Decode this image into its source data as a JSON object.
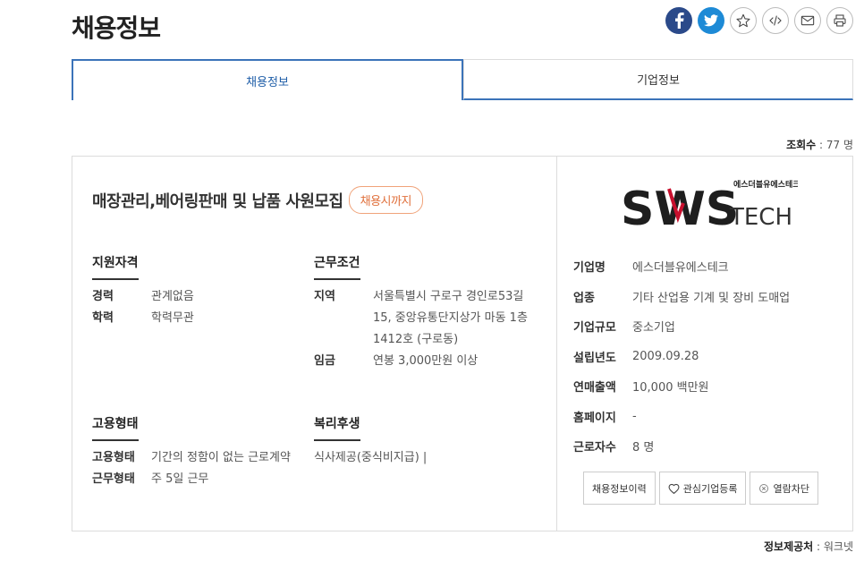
{
  "page": {
    "title": "채용정보"
  },
  "share": {
    "icons": [
      "facebook-icon",
      "twitter-icon",
      "star-icon",
      "code-icon",
      "mail-icon",
      "print-icon"
    ]
  },
  "tabs": [
    {
      "label": "채용정보",
      "active": true
    },
    {
      "label": "기업정보",
      "active": false
    }
  ],
  "views": {
    "label": "조회수",
    "value": ": 77 명"
  },
  "job": {
    "title": "매장관리,베어링판매 및 납품 사원모집",
    "badge": "채용시까지"
  },
  "qualifications": {
    "heading": "지원자격",
    "rows": [
      {
        "k": "경력",
        "v": "관계없음"
      },
      {
        "k": "학력",
        "v": "학력무관"
      }
    ]
  },
  "conditions": {
    "heading": "근무조건",
    "rows": [
      {
        "k": "지역",
        "v": "서울특별시 구로구 경인로53길 15, 중앙유통단지상가 마동 1층 1412호 (구로동)"
      },
      {
        "k": "임금",
        "v": "연봉 3,000만원 이상"
      }
    ]
  },
  "employment": {
    "heading": "고용형태",
    "rows": [
      {
        "k": "고용형태",
        "v": "기간의 정함이 없는 근로계약"
      },
      {
        "k": "근무형태",
        "v": "주 5일 근무"
      }
    ]
  },
  "welfare": {
    "heading": "복리후생",
    "value": "식사제공(중식비지급) |"
  },
  "company": {
    "logo": {
      "main": "SWS",
      "sub": "TECH",
      "korean": "에스더블유에스테크",
      "main_color": "#1e1e1e",
      "accent_color": "#c8102e"
    },
    "rows": [
      {
        "k": "기업명",
        "v": "에스더블유에스테크"
      },
      {
        "k": "업종",
        "v": "기타 산업용 기계 및 장비 도매업"
      },
      {
        "k": "기업규모",
        "v": "중소기업"
      },
      {
        "k": "설립년도",
        "v": "2009.09.28"
      },
      {
        "k": "연매출액",
        "v": "10,000 백만원"
      },
      {
        "k": "홈페이지",
        "v": "-"
      },
      {
        "k": "근로자수",
        "v": "8 명"
      }
    ],
    "buttons": {
      "history": "채용정보이력",
      "interest": "관심기업등록",
      "block": "열람차단"
    }
  },
  "source": {
    "label": "정보제공처",
    "value": ": 워크넷"
  },
  "colors": {
    "accent": "#3b73b9",
    "badge": "#e0703c"
  }
}
